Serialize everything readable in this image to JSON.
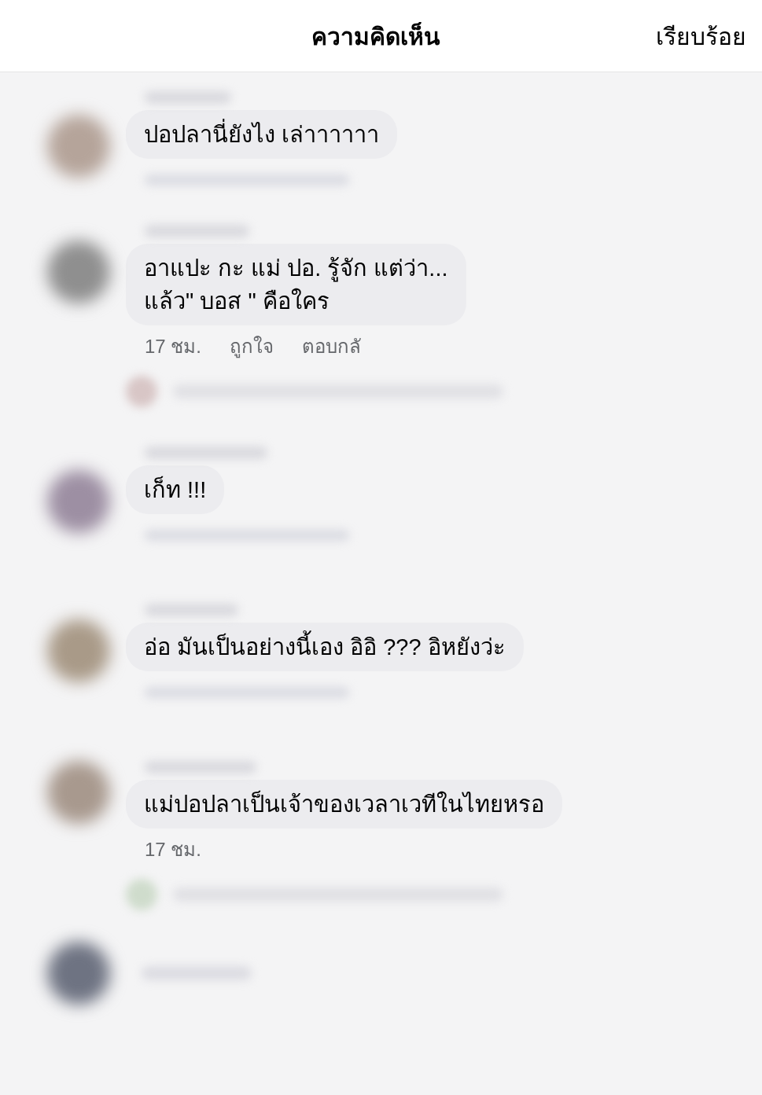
{
  "header": {
    "title": "ความคิดเห็น",
    "done": "เรียบร้อย"
  },
  "comments": [
    {
      "text": "ปอปลานี่ยังไง เล่าาาาาา"
    },
    {
      "text": "อาแปะ กะ แม่ ปอ. รู้จัก แต่ว่า...\nแล้ว\" บอส \" คือใคร",
      "time": "17 ชม.",
      "like": "ถูกใจ",
      "reply": "ตอบกลั"
    },
    {
      "text": "เก็ท !!!"
    },
    {
      "text": "อ่อ มันเป็นอย่างนี้เอง อิอิ ??? อิหยังว่ะ"
    },
    {
      "text": "แม่ปอปลาเป็นเจ้าของเวลาเวทีในไทยหรอ",
      "time": "17 ชม."
    }
  ]
}
